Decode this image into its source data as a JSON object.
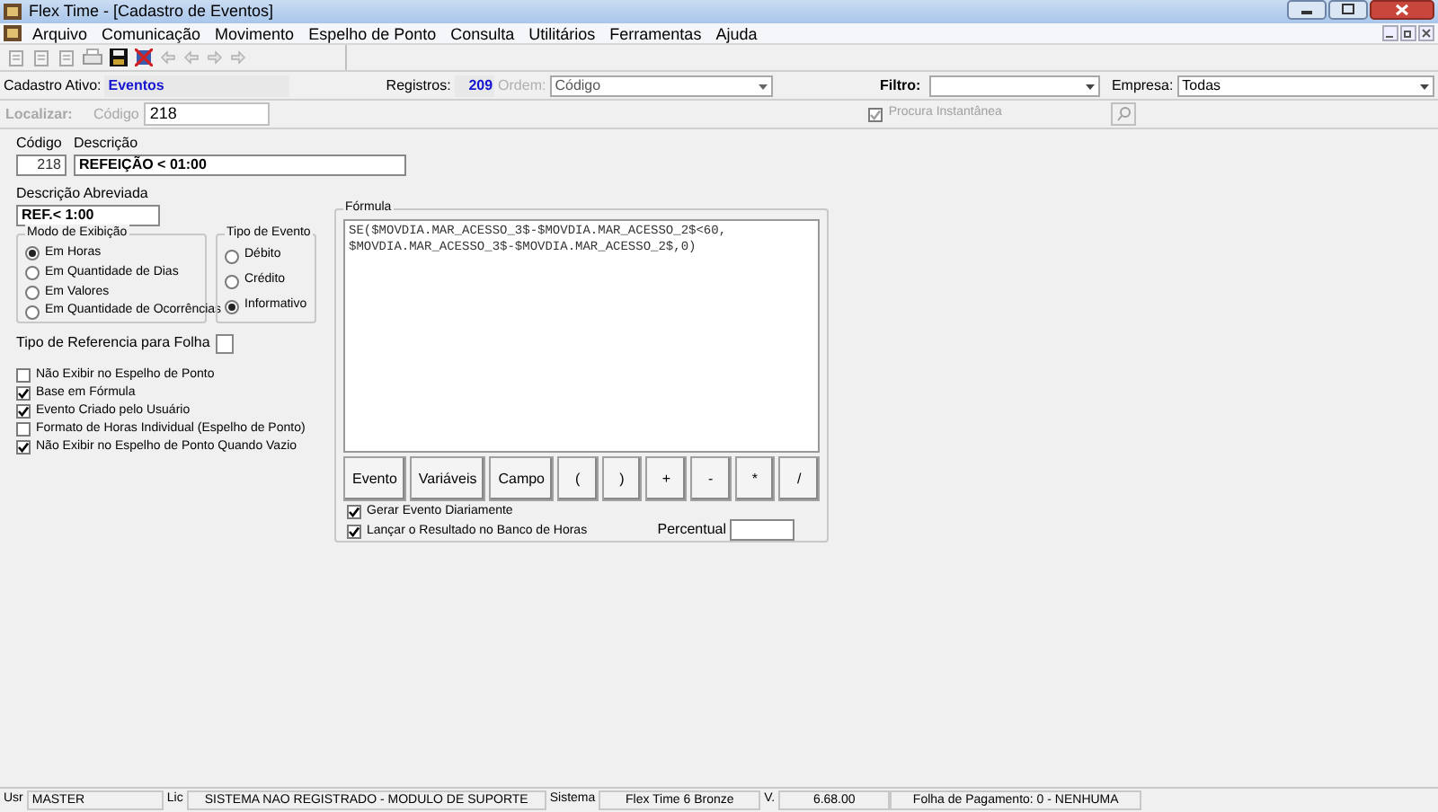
{
  "window": {
    "title": "Flex Time - [Cadastro de Eventos]"
  },
  "menu": [
    "Arquivo",
    "Comunicação",
    "Movimento",
    "Espelho de Ponto",
    "Consulta",
    "Utilitários",
    "Ferramentas",
    "Ajuda"
  ],
  "info_bar": {
    "active_label": "Cadastro Ativo:",
    "active_value": "Eventos",
    "records_label": "Registros:",
    "records_value": "209",
    "order_label": "Ordem:",
    "order_value": "Código",
    "filter_label": "Filtro:",
    "company_label": "Empresa:",
    "company_value": "Todas"
  },
  "search_bar": {
    "label": "Localizar:",
    "field_label": "Código",
    "value": "218",
    "instant": {
      "label": "Procura Instantânea",
      "checked": true,
      "disabled": true
    }
  },
  "form": {
    "code_label": "Código",
    "code_value": "218",
    "description_label": "Descrição",
    "description_value": "REFEIÇÃO < 01:00",
    "short_label": "Descrição Abreviada",
    "short_value": "REF.< 1:00",
    "display_mode": {
      "title": "Modo de Exibição",
      "options": [
        {
          "label": "Em Horas",
          "selected": true
        },
        {
          "label": "Em Quantidade de Dias",
          "selected": false
        },
        {
          "label": "Em Valores",
          "selected": false
        },
        {
          "label": "Em Quantidade de Ocorrências",
          "selected": false
        }
      ]
    },
    "event_type": {
      "title": "Tipo de Evento",
      "options": [
        {
          "label": "Débito",
          "selected": false
        },
        {
          "label": "Crédito",
          "selected": false
        },
        {
          "label": "Informativo",
          "selected": true
        }
      ]
    },
    "ref_type_label": "Tipo de Referencia para Folha",
    "checkboxes": [
      {
        "label": "Não Exibir no Espelho de Ponto",
        "checked": false
      },
      {
        "label": "Base em Fórmula",
        "checked": true
      },
      {
        "label": "Evento Criado pelo Usuário",
        "checked": true
      },
      {
        "label": "Formato de Horas Individual (Espelho de Ponto)",
        "checked": false
      },
      {
        "label": "Não Exibir no Espelho de Ponto Quando Vazio",
        "checked": true
      }
    ]
  },
  "formula": {
    "title": "Fórmula",
    "lines": [
      "SE($MOVDIA.MAR_ACESSO_3$-$MOVDIA.MAR_ACESSO_2$<60,",
      "$MOVDIA.MAR_ACESSO_3$-$MOVDIA.MAR_ACESSO_2$,0)"
    ],
    "buttons": [
      "Evento",
      "Variáveis",
      "Campo",
      "(",
      ")",
      "+",
      "-",
      "*",
      "/"
    ],
    "checkboxes": [
      {
        "label": "Gerar Evento Diariamente",
        "checked": true
      },
      {
        "label": "Lançar o Resultado no Banco de Horas",
        "checked": true
      }
    ],
    "percent_label": "Percentual"
  },
  "status_bar": [
    {
      "label": "Usr",
      "value": "MASTER"
    },
    {
      "label": "Lic",
      "value": "SISTEMA NAO REGISTRADO - MODULO DE SUPORTE"
    },
    {
      "label": "Sistema",
      "value": "Flex Time 6 Bronze"
    },
    {
      "label": "V.",
      "value": "6.68.00"
    },
    {
      "value": "Folha de Pagamento: 0 - NENHUMA"
    }
  ]
}
